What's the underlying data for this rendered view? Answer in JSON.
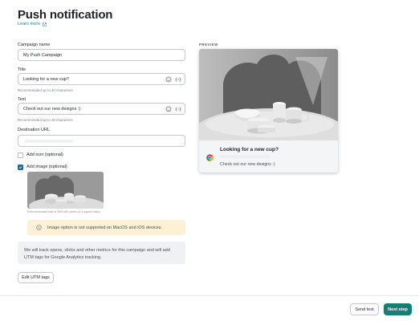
{
  "page": {
    "title": "Push notification",
    "learn_more": "Learn more"
  },
  "form": {
    "campaign_name": {
      "label": "Campaign name",
      "value": "My Push Campaign"
    },
    "title": {
      "label": "Title",
      "value": "Looking for a new cup?",
      "hint": "Recommended up to 40 characters"
    },
    "text": {
      "label": "Text",
      "value": "Check out our new designs :)",
      "hint": "Recommended up to 40 characters"
    },
    "destination_url": {
      "label": "Destination URL",
      "value": ""
    },
    "add_icon": {
      "label": "Add icon (optional)",
      "checked": false
    },
    "add_image": {
      "label": "Add image (optional)",
      "checked": true,
      "note": "Recommended size is 360x180 pixels (2:1 aspect ratio)"
    },
    "warning": "Image option is not supported on MacOS and iOS devices.",
    "utm_info": "We will track opens, clicks and other metrics for this campaign and will add UTM tags for Google Analytics tracking.",
    "edit_utm": "Edit UTM tags"
  },
  "preview": {
    "label": "PREVIEW",
    "title": "Looking for a new cup?",
    "text": "Check out our new designs :)"
  },
  "footer": {
    "send_test": "Send test",
    "next_step": "Next step"
  },
  "colors": {
    "accent": "#1a7d75",
    "link": "#1a8a7e",
    "warning_bg": "#fcf1d4",
    "info_bg": "#f0f1f2",
    "checkbox": "#1f6f8b"
  }
}
